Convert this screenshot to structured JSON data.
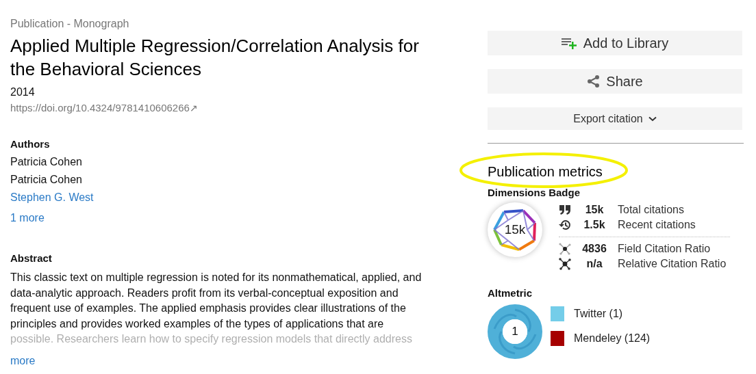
{
  "publication_type": "Publication - Monograph",
  "title": "Applied Multiple Regression/Correlation Analysis for the Behavioral Sciences",
  "year": "2014",
  "doi": "https://doi.org/10.4324/9781410606266",
  "doi_arrow": "↗",
  "authors": {
    "heading": "Authors",
    "items": [
      {
        "name": "Patricia Cohen",
        "linked": false
      },
      {
        "name": "Patricia Cohen",
        "linked": false
      },
      {
        "name": "Stephen G. West",
        "linked": true
      }
    ],
    "more": "1 more"
  },
  "abstract": {
    "heading": "Abstract",
    "text": "This classic text on multiple regression is noted for its nonmathematical, applied, and data-analytic approach. Readers profit from its verbal-conceptual exposition and frequent use of examples. The applied emphasis provides clear illustrations of the principles and provides worked examples of the types of applications that are possible. Researchers learn how to specify regression models that directly address",
    "more": "more"
  },
  "actions": [
    {
      "kind": "library",
      "label": "Add to Library"
    },
    {
      "kind": "share",
      "label": "Share"
    },
    {
      "kind": "export",
      "label": "Export citation"
    }
  ],
  "metrics": {
    "heading": "Publication metrics",
    "highlighted": true,
    "dimensions": {
      "heading": "Dimensions Badge",
      "badge": "15k",
      "rows": [
        {
          "kind": "quote",
          "value": "15k",
          "label": "Total citations"
        },
        {
          "kind": "history",
          "value": "1.5k",
          "label": "Recent citations"
        },
        {
          "kind": "field",
          "value": "4836",
          "label": "Field Citation Ratio"
        },
        {
          "kind": "relative",
          "value": "n/a",
          "label": "Relative Citation Ratio"
        }
      ]
    },
    "altmetric": {
      "heading": "Altmetric",
      "score": "1",
      "sources": [
        {
          "label": "Twitter (1)",
          "color": "#74cde9"
        },
        {
          "label": "Mendeley (124)",
          "color": "#a60000"
        }
      ]
    }
  }
}
